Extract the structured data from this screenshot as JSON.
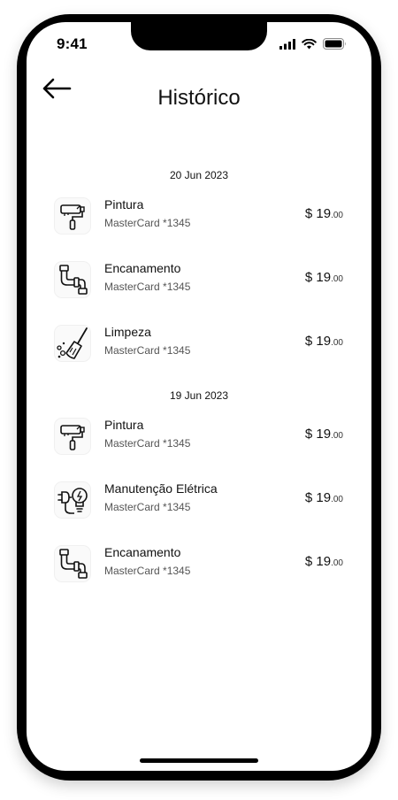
{
  "status_bar": {
    "time": "9:41",
    "icons": [
      "signal-icon",
      "wifi-icon",
      "battery-icon"
    ]
  },
  "header": {
    "back_icon": "arrow-left-icon",
    "title": "Histórico"
  },
  "groups": [
    {
      "date": "20 Jun 2023",
      "items": [
        {
          "icon": "paint-roller-icon",
          "title": "Pintura",
          "card": "MasterCard *1345",
          "currency": "$",
          "amount": "19",
          "cents": ".00"
        },
        {
          "icon": "pipe-icon",
          "title": "Encanamento",
          "card": "MasterCard *1345",
          "currency": "$",
          "amount": "19",
          "cents": ".00"
        },
        {
          "icon": "broom-icon",
          "title": "Limpeza",
          "card": "MasterCard *1345",
          "currency": "$",
          "amount": "19",
          "cents": ".00"
        }
      ]
    },
    {
      "date": "19 Jun 2023",
      "items": [
        {
          "icon": "paint-roller-icon",
          "title": "Pintura",
          "card": "MasterCard *1345",
          "currency": "$",
          "amount": "19",
          "cents": ".00"
        },
        {
          "icon": "plug-bulb-icon",
          "title": "Manutenção Elétrica",
          "card": "MasterCard *1345",
          "currency": "$",
          "amount": "19",
          "cents": ".00"
        },
        {
          "icon": "pipe-icon",
          "title": "Encanamento",
          "card": "MasterCard *1345",
          "currency": "$",
          "amount": "19",
          "cents": ".00"
        }
      ]
    }
  ]
}
